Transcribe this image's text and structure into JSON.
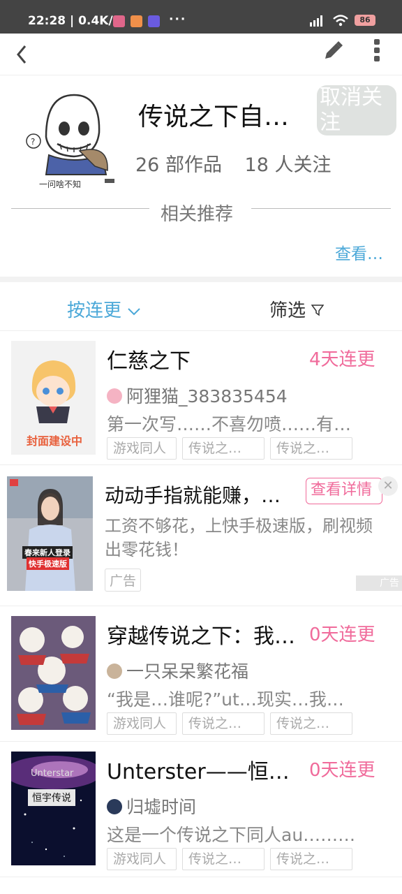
{
  "status_bar": {
    "time": "22:28 | 0.4K/s",
    "dots": "···",
    "battery": "86"
  },
  "header": {
    "title": "传说之下自…",
    "unfollow": "取消关注",
    "works": "26 部作品",
    "followers": "18 人关注",
    "related": "相关推荐",
    "see_more": "查看…"
  },
  "sort": {
    "label": "按连更",
    "filter": "筛选"
  },
  "items": [
    {
      "title": "仁慈之下",
      "update": "4天连更",
      "author": "阿狸猫_383835454",
      "desc": "第一次写……不喜勿喷……有…",
      "cover_text": "封面建设中",
      "tags": [
        "游戏同人",
        "传说之…",
        "传说之…"
      ]
    },
    {
      "title": "穿越传说之下：我…",
      "update": "0天连更",
      "author": "一只呆呆繁花福",
      "desc": "“我是…谁呢?”ut…现实…我…",
      "tags": [
        "游戏同人",
        "传说之…",
        "传说之…"
      ]
    },
    {
      "title": "Unterster——恒…",
      "update": "0天连更",
      "author": "归墟时间",
      "desc": "这是一个传说之下同人au………",
      "cover_text_1": "Unterstar",
      "cover_text_2": "恒宇传说",
      "tags": [
        "游戏同人",
        "传说之…",
        "传说之…"
      ]
    }
  ],
  "ad": {
    "title": "动动手指就能赚，…",
    "button": "查看详情",
    "close": "✕",
    "desc": "工资不够花，上快手极速版，刷视频出零花钱！",
    "tag": "广告",
    "mark": "广告",
    "cover_text_1": "春来新人登录",
    "cover_text_2": "快手极速版"
  }
}
